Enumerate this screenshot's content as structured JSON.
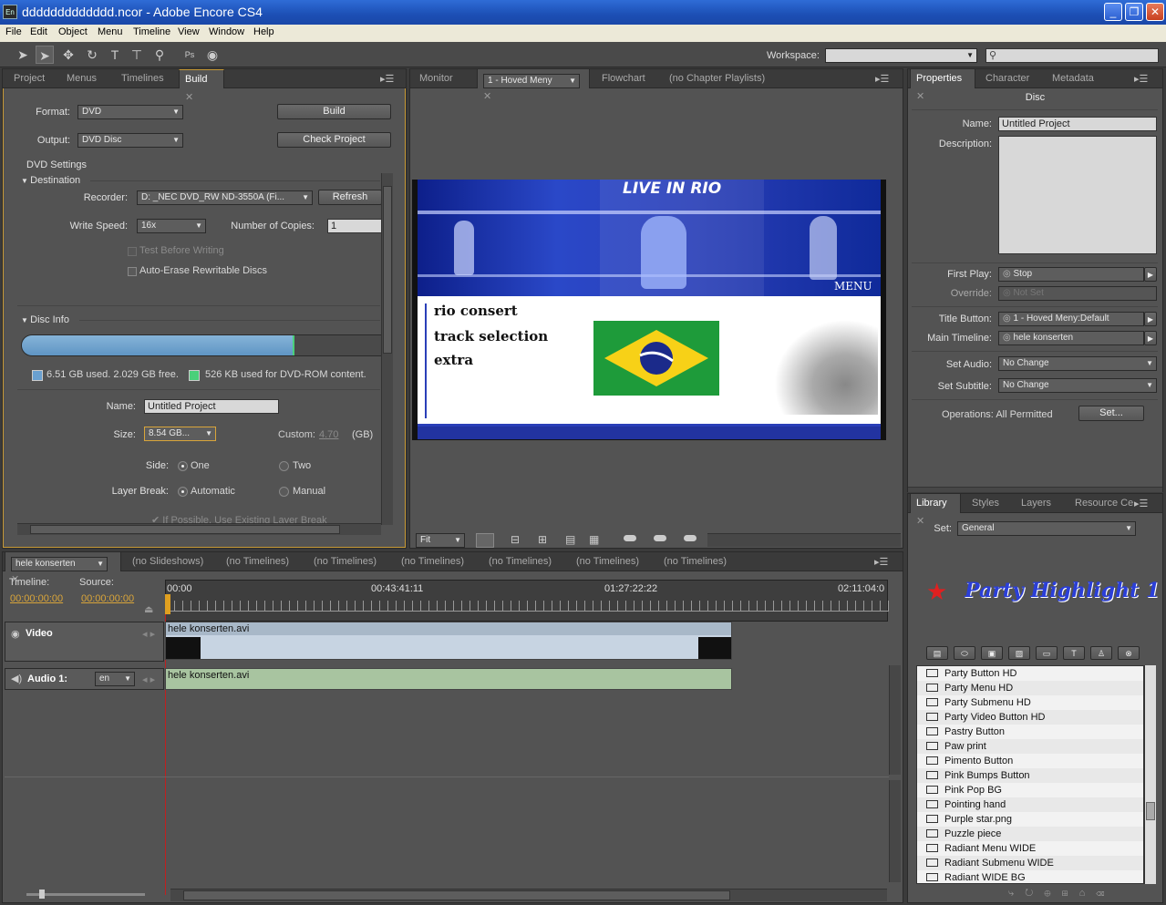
{
  "window": {
    "title": "ddddddddddddd.ncor - Adobe Encore CS4",
    "app_icon": "En",
    "minimize": "_",
    "maximize": "❐",
    "close": "✕"
  },
  "menubar": [
    "File",
    "Edit",
    "Object",
    "Menu",
    "Timeline",
    "View",
    "Window",
    "Help"
  ],
  "toolbar": {
    "workspace_label": "Workspace:",
    "workspace_value": "",
    "search_placeholder": ""
  },
  "build_panel": {
    "tabs": [
      "Project",
      "Menus",
      "Timelines",
      "Build"
    ],
    "format_label": "Format:",
    "format_value": "DVD",
    "output_label": "Output:",
    "output_value": "DVD Disc",
    "build_button": "Build",
    "check_button": "Check Project",
    "dvd_settings": "DVD Settings",
    "destination": "Destination",
    "recorder_label": "Recorder:",
    "recorder_value": "D: _NEC DVD_RW ND-3550A (Fi...",
    "refresh": "Refresh",
    "write_speed_label": "Write Speed:",
    "write_speed_value": "16x",
    "copies_label": "Number of Copies:",
    "copies_value": "1",
    "test_before": "Test Before Writing",
    "auto_erase": "Auto-Erase Rewritable Discs",
    "disc_info": "Disc Info",
    "usage_text": "6.51 GB used.  2.029 GB free.",
    "rom_text": "526 KB used for DVD-ROM content.",
    "used_fraction": 0.76,
    "name_label": "Name:",
    "name_value": "Untitled Project",
    "size_label": "Size:",
    "size_value": "8.54 GB...",
    "custom_label": "Custom:",
    "custom_value": "4.70",
    "custom_unit": "(GB)",
    "side_label": "Side:",
    "side_one": "One",
    "side_two": "Two",
    "layer_label": "Layer Break:",
    "layer_auto": "Automatic",
    "layer_manual": "Manual",
    "existing_break": "If Possible, Use Existing Layer Break"
  },
  "monitor": {
    "tabs": [
      "Monitor",
      "1 - Hoved Meny",
      "Flowchart",
      "(no Chapter Playlists)"
    ],
    "zoom": "Fit",
    "preview": {
      "banner": "LIVE IN RIO",
      "menu_tag": "MENU",
      "items": [
        "rio consert",
        "track selection",
        "extra"
      ]
    }
  },
  "properties": {
    "tabs": [
      "Properties",
      "Character",
      "Metadata"
    ],
    "heading": "Disc",
    "name_label": "Name:",
    "name_value": "Untitled Project",
    "desc_label": "Description:",
    "first_play_label": "First Play:",
    "first_play_value": "Stop",
    "override_label": "Override:",
    "override_value": "Not Set",
    "title_button_label": "Title Button:",
    "title_button_value": "1 - Hoved Meny:Default",
    "main_timeline_label": "Main Timeline:",
    "main_timeline_value": "hele konserten",
    "set_audio_label": "Set Audio:",
    "set_audio_value": "No Change",
    "set_subtitle_label": "Set Subtitle:",
    "set_subtitle_value": "No Change",
    "operations": "Operations: All Permitted",
    "set_button": "Set..."
  },
  "timeline": {
    "tabs": [
      "hele konserten",
      "(no Slideshows)",
      "(no Timelines)",
      "(no Timelines)",
      "(no Timelines)",
      "(no Timelines)",
      "(no Timelines)",
      "(no Timelines)"
    ],
    "timeline_label": "Timeline:",
    "source_label": "Source:",
    "timeline_tc": "00:00:00:00",
    "source_tc": "00:00:00:00",
    "ruler": [
      "00:00",
      "00:43:41:11",
      "01:27:22:22",
      "02:11:04:0"
    ],
    "video_track": "Video",
    "video_clip": "hele konserten.avi",
    "audio_track": "Audio 1:",
    "audio_lang": "en",
    "audio_clip": "hele konserten.avi"
  },
  "library": {
    "tabs": [
      "Library",
      "Styles",
      "Layers",
      "Resource Ce"
    ],
    "set_label": "Set:",
    "set_value": "General",
    "preview_title": "Party Highlight 1",
    "items": [
      "Party Button HD",
      "Party Menu HD",
      "Party Submenu HD",
      "Party Video Button HD",
      "Pastry Button",
      "Paw print",
      "Pimento Button",
      "Pink Bumps Button",
      "Pink Pop BG",
      "Pointing hand",
      "Purple star.png",
      "Puzzle piece",
      "Radiant Menu WIDE",
      "Radiant Submenu WIDE",
      "Radiant WIDE BG"
    ],
    "item_icons": [
      "button",
      "menu",
      "submenu",
      "button",
      "button",
      "image",
      "button",
      "button",
      "bg",
      "image",
      "image",
      "image",
      "submenu",
      "submenu",
      "bg"
    ]
  }
}
